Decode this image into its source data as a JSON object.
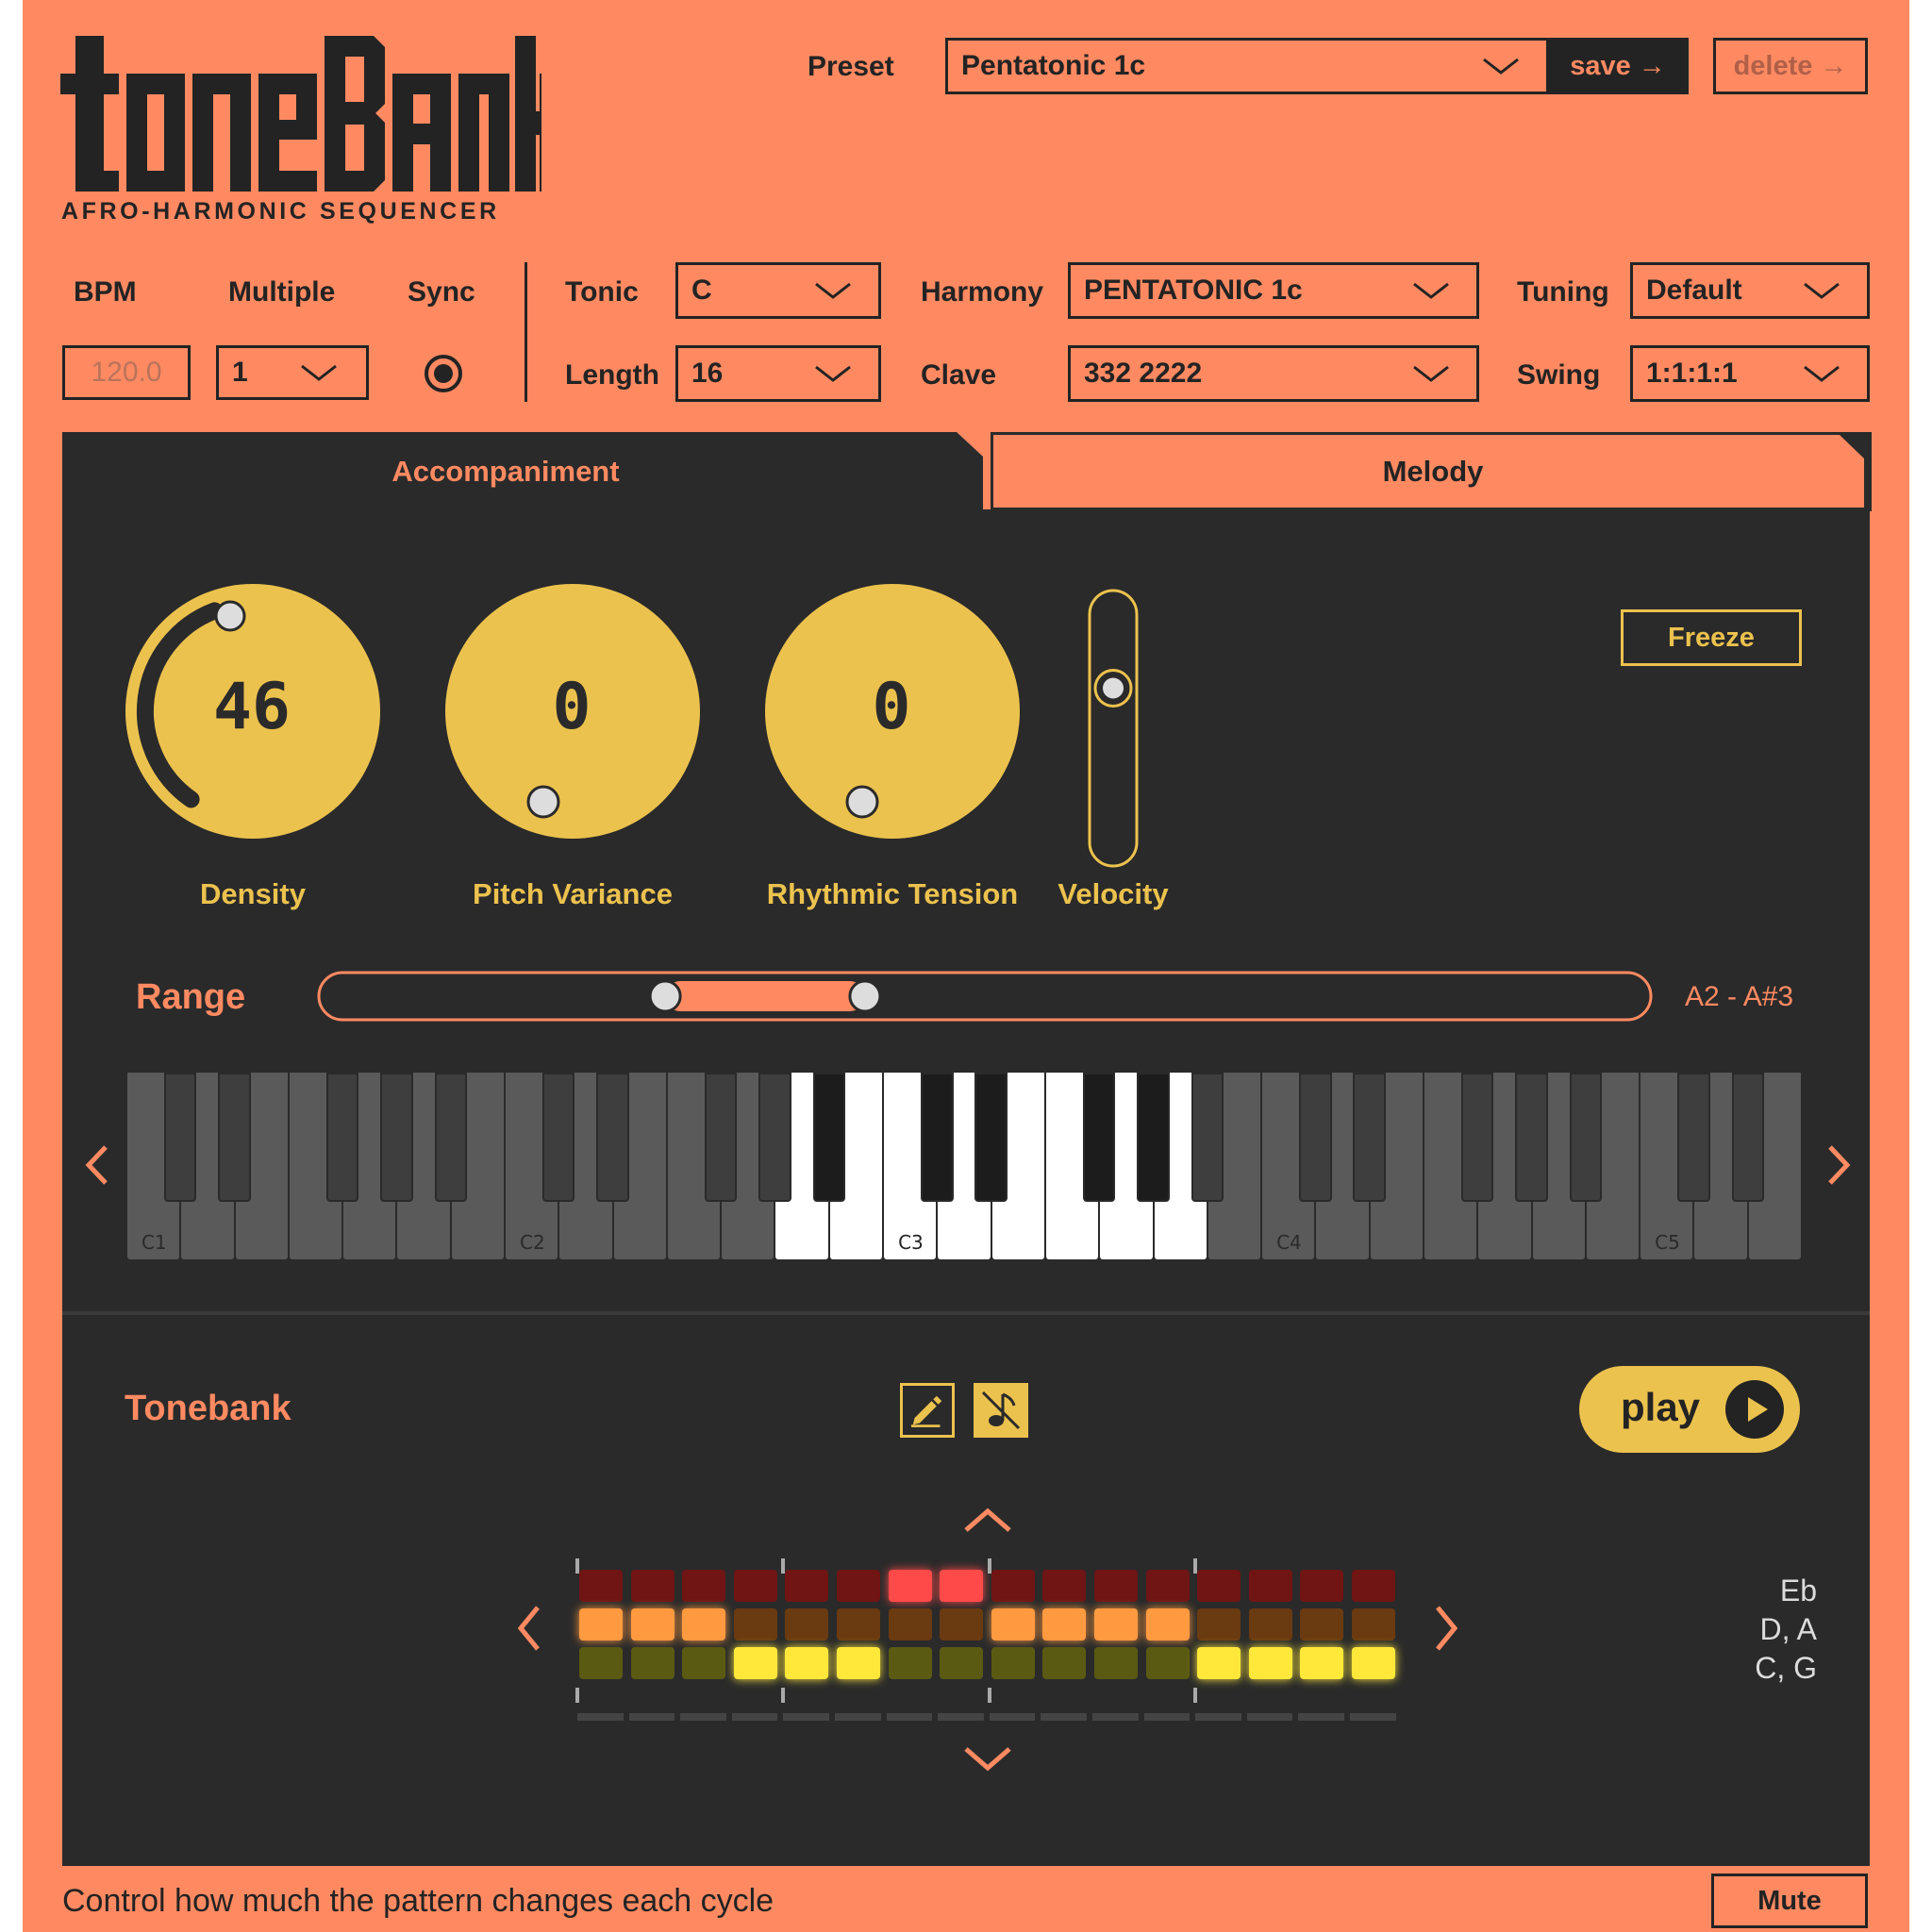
{
  "app": {
    "logo_text": "TONEBANK",
    "subtitle": "AFRO-HARMONIC SEQUENCER"
  },
  "header": {
    "preset_label": "Preset",
    "preset_value": "Pentatonic 1c",
    "save_label": "save →",
    "delete_label": "delete →"
  },
  "controls": {
    "bpm_label": "BPM",
    "bpm_value": "120.0",
    "multiple_label": "Multiple",
    "multiple_value": "1",
    "sync_label": "Sync",
    "sync_on": true,
    "tonic_label": "Tonic",
    "tonic_value": "C",
    "length_label": "Length",
    "length_value": "16",
    "harmony_label": "Harmony",
    "harmony_value": "PENTATONIC 1c",
    "clave_label": "Clave",
    "clave_value": "332 2222",
    "tuning_label": "Tuning",
    "tuning_value": "Default",
    "swing_label": "Swing",
    "swing_value": "1:1:1:1"
  },
  "tabs": [
    {
      "label": "Accompaniment",
      "active": true
    },
    {
      "label": "Melody",
      "active": false
    }
  ],
  "knobs": [
    {
      "label": "Density",
      "value": "46",
      "fraction": 0.46
    },
    {
      "label": "Pitch Variance",
      "value": "0",
      "fraction": 0
    },
    {
      "label": "Rhythmic Tension",
      "value": "0",
      "fraction": 0
    }
  ],
  "velocity": {
    "label": "Velocity",
    "level": 0.65
  },
  "freeze_label": "Freeze",
  "range": {
    "label": "Range",
    "value": "A2 - A#3",
    "low_fraction": 0.26,
    "high_fraction": 0.41
  },
  "keyboard": {
    "octave_labels": [
      "C1",
      "C2",
      "C3",
      "C4",
      "C5"
    ],
    "active_white_keys": [
      12,
      13,
      14,
      15,
      16,
      17,
      18,
      19
    ]
  },
  "tonebank": {
    "title": "Tonebank",
    "play_label": "play",
    "note_labels": [
      "Eb",
      "D, A",
      "C, G"
    ]
  },
  "sequencer": {
    "steps": 16,
    "rows": [
      {
        "color_on": "#ff4a4a",
        "color_dim": "#701414",
        "active": [
          6,
          7
        ]
      },
      {
        "color_on": "#ff9a40",
        "color_dim": "#6a3a10",
        "active": [
          0,
          1,
          2,
          8,
          9,
          10,
          11
        ]
      },
      {
        "color_on": "#ffe83a",
        "color_dim": "#5a5a12",
        "active": [
          3,
          4,
          5,
          12,
          13,
          14,
          15
        ]
      }
    ]
  },
  "footer": {
    "status": "Control how much the pattern changes each cycle",
    "mute_label": "Mute"
  },
  "colors": {
    "bg": "#ff8a62",
    "panel": "#2a2a2a",
    "yellow": "#ecc24e",
    "dark": "#232323"
  }
}
